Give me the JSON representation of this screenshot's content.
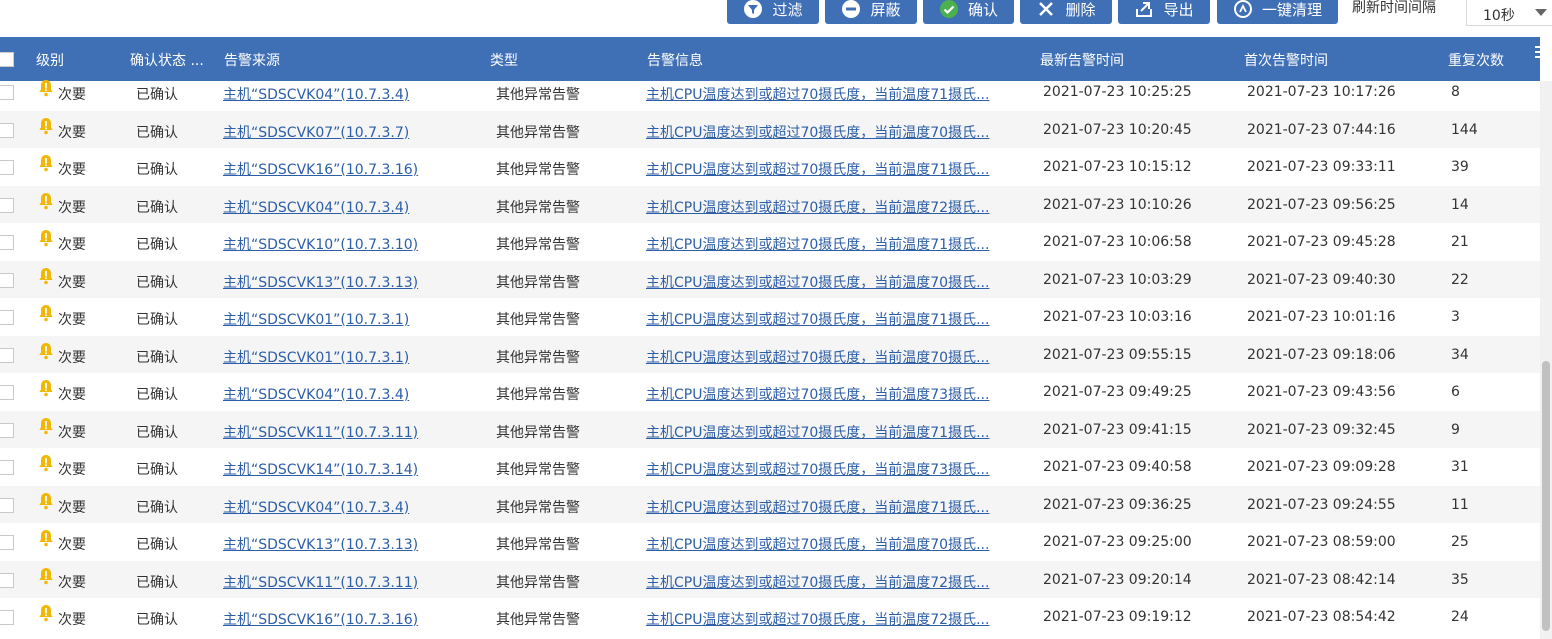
{
  "toolbar": {
    "buttons": [
      {
        "label": "过滤",
        "icon": "filter-icon"
      },
      {
        "label": "屏蔽",
        "icon": "block-icon"
      },
      {
        "label": "确认",
        "icon": "check-circle-icon"
      },
      {
        "label": "删除",
        "icon": "close-icon"
      },
      {
        "label": "导出",
        "icon": "export-icon"
      },
      {
        "label": "一键清理",
        "icon": "clean-icon"
      }
    ],
    "refresh_label": "刷新时间间隔",
    "refresh_value": "10秒"
  },
  "colors": {
    "header_bg": "#3f6fb5",
    "link": "#2d5ea8",
    "warning_icon": "#f2b705",
    "check_green": "#4caf50"
  },
  "table": {
    "headers": {
      "level": "级别",
      "ack": "确认状态 ...",
      "source": "告警来源",
      "type": "类型",
      "info": "告警信息",
      "latest": "最新告警时间",
      "first": "首次告警时间",
      "count": "重复次数"
    },
    "rows": [
      {
        "level": "次要",
        "ack": "已确认",
        "source": "主机“SDSCVK04”(10.7.3.4)",
        "type": "其他异常告警",
        "info": "主机CPU温度达到或超过70摄氏度，当前温度71摄氏...",
        "latest": "2021-07-23 10:25:25",
        "first": "2021-07-23 10:17:26",
        "count": "8"
      },
      {
        "level": "次要",
        "ack": "已确认",
        "source": "主机“SDSCVK07”(10.7.3.7)",
        "type": "其他异常告警",
        "info": "主机CPU温度达到或超过70摄氏度，当前温度70摄氏...",
        "latest": "2021-07-23 10:20:45",
        "first": "2021-07-23 07:44:16",
        "count": "144"
      },
      {
        "level": "次要",
        "ack": "已确认",
        "source": "主机“SDSCVK16”(10.7.3.16)",
        "type": "其他异常告警",
        "info": "主机CPU温度达到或超过70摄氏度，当前温度71摄氏...",
        "latest": "2021-07-23 10:15:12",
        "first": "2021-07-23 09:33:11",
        "count": "39"
      },
      {
        "level": "次要",
        "ack": "已确认",
        "source": "主机“SDSCVK04”(10.7.3.4)",
        "type": "其他异常告警",
        "info": "主机CPU温度达到或超过70摄氏度，当前温度72摄氏...",
        "latest": "2021-07-23 10:10:26",
        "first": "2021-07-23 09:56:25",
        "count": "14"
      },
      {
        "level": "次要",
        "ack": "已确认",
        "source": "主机“SDSCVK10”(10.7.3.10)",
        "type": "其他异常告警",
        "info": "主机CPU温度达到或超过70摄氏度，当前温度71摄氏...",
        "latest": "2021-07-23 10:06:58",
        "first": "2021-07-23 09:45:28",
        "count": "21"
      },
      {
        "level": "次要",
        "ack": "已确认",
        "source": "主机“SDSCVK13”(10.7.3.13)",
        "type": "其他异常告警",
        "info": "主机CPU温度达到或超过70摄氏度，当前温度70摄氏...",
        "latest": "2021-07-23 10:03:29",
        "first": "2021-07-23 09:40:30",
        "count": "22"
      },
      {
        "level": "次要",
        "ack": "已确认",
        "source": "主机“SDSCVK01”(10.7.3.1)",
        "type": "其他异常告警",
        "info": "主机CPU温度达到或超过70摄氏度，当前温度71摄氏...",
        "latest": "2021-07-23 10:03:16",
        "first": "2021-07-23 10:01:16",
        "count": "3"
      },
      {
        "level": "次要",
        "ack": "已确认",
        "source": "主机“SDSCVK01”(10.7.3.1)",
        "type": "其他异常告警",
        "info": "主机CPU温度达到或超过70摄氏度，当前温度70摄氏...",
        "latest": "2021-07-23 09:55:15",
        "first": "2021-07-23 09:18:06",
        "count": "34"
      },
      {
        "level": "次要",
        "ack": "已确认",
        "source": "主机“SDSCVK04”(10.7.3.4)",
        "type": "其他异常告警",
        "info": "主机CPU温度达到或超过70摄氏度，当前温度73摄氏...",
        "latest": "2021-07-23 09:49:25",
        "first": "2021-07-23 09:43:56",
        "count": "6"
      },
      {
        "level": "次要",
        "ack": "已确认",
        "source": "主机“SDSCVK11”(10.7.3.11)",
        "type": "其他异常告警",
        "info": "主机CPU温度达到或超过70摄氏度，当前温度71摄氏...",
        "latest": "2021-07-23 09:41:15",
        "first": "2021-07-23 09:32:45",
        "count": "9"
      },
      {
        "level": "次要",
        "ack": "已确认",
        "source": "主机“SDSCVK14”(10.7.3.14)",
        "type": "其他异常告警",
        "info": "主机CPU温度达到或超过70摄氏度，当前温度73摄氏...",
        "latest": "2021-07-23 09:40:58",
        "first": "2021-07-23 09:09:28",
        "count": "31"
      },
      {
        "level": "次要",
        "ack": "已确认",
        "source": "主机“SDSCVK04”(10.7.3.4)",
        "type": "其他异常告警",
        "info": "主机CPU温度达到或超过70摄氏度，当前温度71摄氏...",
        "latest": "2021-07-23 09:36:25",
        "first": "2021-07-23 09:24:55",
        "count": "11"
      },
      {
        "level": "次要",
        "ack": "已确认",
        "source": "主机“SDSCVK13”(10.7.3.13)",
        "type": "其他异常告警",
        "info": "主机CPU温度达到或超过70摄氏度，当前温度70摄氏...",
        "latest": "2021-07-23 09:25:00",
        "first": "2021-07-23 08:59:00",
        "count": "25"
      },
      {
        "level": "次要",
        "ack": "已确认",
        "source": "主机“SDSCVK11”(10.7.3.11)",
        "type": "其他异常告警",
        "info": "主机CPU温度达到或超过70摄氏度，当前温度72摄氏...",
        "latest": "2021-07-23 09:20:14",
        "first": "2021-07-23 08:42:14",
        "count": "35"
      },
      {
        "level": "次要",
        "ack": "已确认",
        "source": "主机“SDSCVK16”(10.7.3.16)",
        "type": "其他异常告警",
        "info": "主机CPU温度达到或超过70摄氏度，当前温度72摄氏...",
        "latest": "2021-07-23 09:19:12",
        "first": "2021-07-23 08:54:42",
        "count": "24"
      }
    ]
  }
}
